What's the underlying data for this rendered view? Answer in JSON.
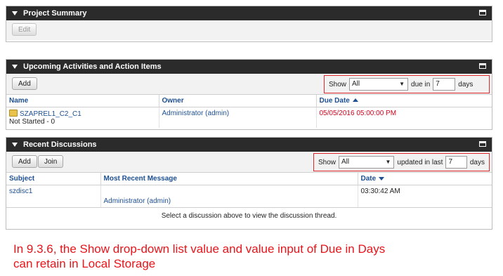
{
  "project_summary": {
    "title": "Project Summary",
    "edit_label": "Edit"
  },
  "activities": {
    "title": "Upcoming Activities and Action Items",
    "add_label": "Add",
    "filter": {
      "show_label": "Show",
      "show_value": "All",
      "due_label": "due in",
      "days_value": "7",
      "days_label": "days"
    },
    "columns": {
      "name": "Name",
      "owner": "Owner",
      "due_date": "Due Date"
    },
    "rows": [
      {
        "name": "SZAPREL1_C2_C1",
        "status": "Not Started - 0",
        "owner": "Administrator (admin)",
        "due_date": "05/05/2016 05:00:00 PM"
      }
    ]
  },
  "discussions": {
    "title": "Recent Discussions",
    "add_label": "Add",
    "join_label": "Join",
    "filter": {
      "show_label": "Show",
      "show_value": "All",
      "updated_label": "updated in last",
      "days_value": "7",
      "days_label": "days"
    },
    "columns": {
      "subject": "Subject",
      "message": "Most Recent Message",
      "date": "Date"
    },
    "rows": [
      {
        "subject": "szdisc1",
        "author": "Administrator (admin)",
        "date": "03:30:42 AM"
      }
    ],
    "footer": "Select a discussion above to view the discussion thread."
  },
  "caption": {
    "line1": "In 9.3.6, the Show drop-down list value and value input of Due in Days",
    "line2": "can retain in Local Storage"
  },
  "colors": {
    "header_bg": "#2b2b2b",
    "link": "#1d4f91",
    "highlight": "#e0282c",
    "caption": "#e8141a"
  }
}
